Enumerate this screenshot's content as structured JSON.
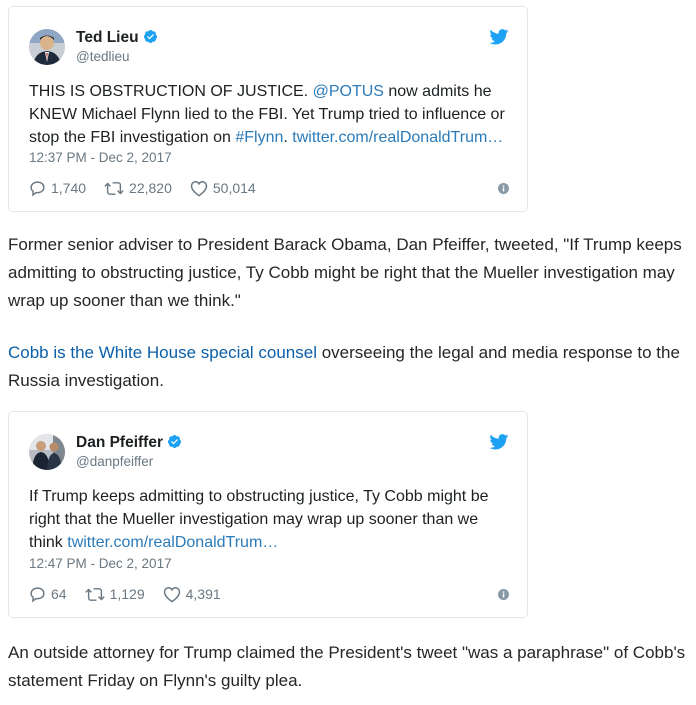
{
  "tweets": [
    {
      "author": "Ted Lieu",
      "handle": "@tedlieu",
      "text_1": "THIS IS OBSTRUCTION OF JUSTICE. ",
      "mention": "@POTUS",
      "text_2": " now admits he KNEW Michael Flynn lied to the FBI. Yet Trump tried to influence or stop the FBI investigation on ",
      "hashtag": "#Flynn",
      "text_3": ". ",
      "link": "twitter.com/realDonaldTrum…",
      "timestamp": "12:37 PM - Dec 2, 2017",
      "replies": "1,740",
      "retweets": "22,820",
      "likes": "50,014"
    },
    {
      "author": "Dan Pfeiffer",
      "handle": "@danpfeiffer",
      "text_1": "If Trump keeps admitting to obstructing justice, Ty Cobb might be right that the Mueller investigation may wrap up sooner than we think ",
      "link": "twitter.com/realDonaldTrum…",
      "timestamp": "12:47 PM - Dec 2, 2017",
      "replies": "64",
      "retweets": "1,129",
      "likes": "4,391"
    }
  ],
  "article": {
    "p1": "Former senior adviser to President Barack Obama, Dan Pfeiffer, tweeted, \"If Trump keeps admitting to obstructing justice, Ty Cobb might be right that the Mueller investigation may wrap up sooner than we think.\"",
    "p2_link": "Cobb is the White House special counsel",
    "p2_rest": " overseeing the legal and media response to the Russia investigation.",
    "p3": "An outside attorney for Trump claimed the President's tweet \"was a paraphrase\" of Cobb's statement Friday on Flynn's guilty plea."
  },
  "colors": {
    "twitter_blue": "#1da1f2",
    "tweet_link": "#2b7bb9",
    "article_link": "#0c5fa8",
    "muted": "#697882"
  },
  "icons": [
    "verified-badge-icon",
    "twitter-bird-icon",
    "reply-icon",
    "retweet-icon",
    "like-icon",
    "info-icon"
  ]
}
